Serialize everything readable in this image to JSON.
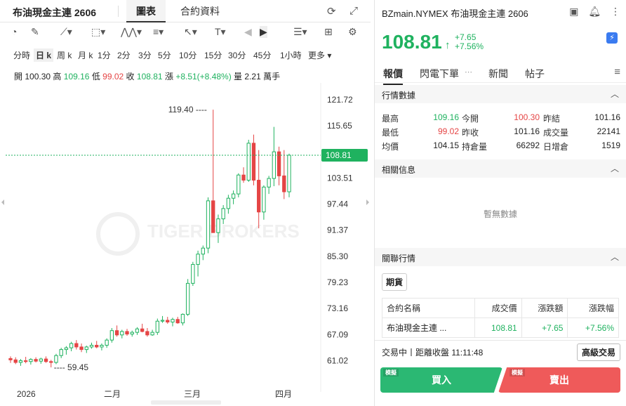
{
  "left_panel": {
    "title": "布油現金主連 2606",
    "tabs": [
      "圖表",
      "合約資料"
    ],
    "periods": [
      "分時",
      "日 k",
      "周 k",
      "月 k",
      "1分",
      "2分",
      "3分",
      "5分",
      "10分",
      "15分",
      "30分",
      "45分",
      "1小時",
      "更多 ▾"
    ],
    "active_period": "日 k",
    "ohlc": {
      "open_label": "開",
      "open": "100.30",
      "high_label": "高",
      "high": "109.16",
      "low_label": "低",
      "low": "99.02",
      "close_label": "收",
      "close": "108.81",
      "change_label": "漲",
      "change": "+8.51(+8.48%)",
      "volume_label": "量",
      "volume": "2.21 萬手"
    },
    "watermark": "TIGER BROKERS"
  },
  "chart_data": {
    "type": "candlestick",
    "ylim": [
      57,
      124
    ],
    "y_ticks": [
      121.72,
      115.65,
      108.81,
      103.51,
      97.44,
      91.37,
      85.3,
      79.23,
      73.16,
      67.09,
      61.02
    ],
    "x_labels": [
      "2026",
      "二月",
      "三月",
      "四月"
    ],
    "last_price": "108.81",
    "high_annotation": "119.40",
    "low_annotation": "59.45",
    "colors": {
      "up": "#1fb25f",
      "down": "#e54545",
      "last": "#1fb25f"
    },
    "candles": [
      [
        61.5,
        62.0,
        60.5,
        61.2
      ],
      [
        61.2,
        61.8,
        60.2,
        60.6
      ],
      [
        60.6,
        61.4,
        59.8,
        61.0
      ],
      [
        61.0,
        61.9,
        60.4,
        60.8
      ],
      [
        60.8,
        61.6,
        60.1,
        61.3
      ],
      [
        61.3,
        61.8,
        60.6,
        60.9
      ],
      [
        60.9,
        61.7,
        60.3,
        61.4
      ],
      [
        61.4,
        62.0,
        60.5,
        60.8
      ],
      [
        60.8,
        61.2,
        59.45,
        60.6
      ],
      [
        60.6,
        62.6,
        60.2,
        62.2
      ],
      [
        62.2,
        64.0,
        61.6,
        63.6
      ],
      [
        63.6,
        64.4,
        62.4,
        64.0
      ],
      [
        64.0,
        65.4,
        63.2,
        65.0
      ],
      [
        65.0,
        65.8,
        63.6,
        64.2
      ],
      [
        64.2,
        65.0,
        63.0,
        63.6
      ],
      [
        63.6,
        64.5,
        62.8,
        64.2
      ],
      [
        64.2,
        65.2,
        63.8,
        64.6
      ],
      [
        64.6,
        65.6,
        63.9,
        64.2
      ],
      [
        64.2,
        65.0,
        63.4,
        64.6
      ],
      [
        64.6,
        66.2,
        64.0,
        65.8
      ],
      [
        65.8,
        68.6,
        65.2,
        68.0
      ],
      [
        68.0,
        69.2,
        66.6,
        67.0
      ],
      [
        67.0,
        68.2,
        66.2,
        67.8
      ],
      [
        67.8,
        68.4,
        66.8,
        67.2
      ],
      [
        67.2,
        68.0,
        66.6,
        67.6
      ],
      [
        67.6,
        68.8,
        67.0,
        68.4
      ],
      [
        68.4,
        69.6,
        67.6,
        67.8
      ],
      [
        67.8,
        68.6,
        66.6,
        67.0
      ],
      [
        67.0,
        68.2,
        66.8,
        67.6
      ],
      [
        67.6,
        70.8,
        67.0,
        70.2
      ],
      [
        70.2,
        71.4,
        69.8,
        70.4
      ],
      [
        70.4,
        71.2,
        69.6,
        70.0
      ],
      [
        70.0,
        71.0,
        69.0,
        70.6
      ],
      [
        70.6,
        71.2,
        69.6,
        69.8
      ],
      [
        69.8,
        72.0,
        69.2,
        71.8
      ],
      [
        71.8,
        80.0,
        71.4,
        79.0
      ],
      [
        79.0,
        84.0,
        78.4,
        83.4
      ],
      [
        83.4,
        86.6,
        80.6,
        85.8
      ],
      [
        85.8,
        87.8,
        84.4,
        87.2
      ],
      [
        87.2,
        99.0,
        86.0,
        98.2
      ],
      [
        98.2,
        119.4,
        91.0,
        90.8
      ],
      [
        90.8,
        95.0,
        88.4,
        94.0
      ],
      [
        94.0,
        97.2,
        92.8,
        96.4
      ],
      [
        96.4,
        99.6,
        95.2,
        98.8
      ],
      [
        98.8,
        100.6,
        97.4,
        99.8
      ],
      [
        99.8,
        104.6,
        99.0,
        104.2
      ],
      [
        104.2,
        106.0,
        102.4,
        103.0
      ],
      [
        103.0,
        112.4,
        102.6,
        111.6
      ],
      [
        111.6,
        113.6,
        101.8,
        103.0
      ],
      [
        103.0,
        110.0,
        91.8,
        95.6
      ],
      [
        95.6,
        101.8,
        93.8,
        101.4
      ],
      [
        101.4,
        104.0,
        99.8,
        103.4
      ],
      [
        103.4,
        115.4,
        101.6,
        109.6
      ],
      [
        109.6,
        110.8,
        101.8,
        104.0
      ],
      [
        104.0,
        110.0,
        98.6,
        100.3
      ],
      [
        100.3,
        109.16,
        99.02,
        108.81
      ]
    ]
  },
  "right_panel": {
    "header": "BZmain.NYMEX 布油現金主連 2606",
    "price": "108.81",
    "change": "+7.65",
    "change_pct": "+7.56%",
    "tabs": [
      "報價",
      "閃電下單",
      "新聞",
      "帖子"
    ],
    "market_data_title": "行情數據",
    "quotes": [
      [
        {
          "label": "最高",
          "value": "109.16",
          "color": "g"
        },
        {
          "label": "今開",
          "value": "100.30",
          "color": "r"
        },
        {
          "label": "昨結",
          "value": "101.16",
          "color": ""
        }
      ],
      [
        {
          "label": "最低",
          "value": "99.02",
          "color": "r"
        },
        {
          "label": "昨收",
          "value": "101.16",
          "color": ""
        },
        {
          "label": "成交量",
          "value": "22141",
          "color": ""
        }
      ],
      [
        {
          "label": "均價",
          "value": "104.15",
          "color": ""
        },
        {
          "label": "持倉量",
          "value": "66292",
          "color": ""
        },
        {
          "label": "日增倉",
          "value": "1519",
          "color": ""
        }
      ]
    ],
    "related_info_title": "相關信息",
    "no_data": "暫無數據",
    "related_market_title": "關聯行情",
    "futures_btn": "期貨",
    "table_headers": [
      "合約名稱",
      "成交價",
      "漲跌額",
      "漲跌幅"
    ],
    "table_row": [
      "布油現金主連 ...",
      "108.81",
      "+7.65",
      "+7.56%"
    ],
    "status_text": "交易中丨距離收盤 11:11:48",
    "advanced_btn": "高級交易",
    "buy_btn": "買入",
    "sell_btn": "賣出",
    "sim_tag": "模擬"
  }
}
